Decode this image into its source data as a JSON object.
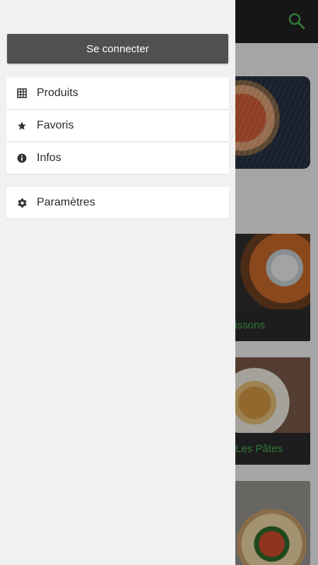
{
  "drawer": {
    "login_button": "Se connecter",
    "items": [
      {
        "label": "Produits",
        "icon": "grid-icon"
      },
      {
        "label": "Favoris",
        "icon": "star-icon"
      },
      {
        "label": "Infos",
        "icon": "info-icon"
      },
      {
        "label": "Paramètres",
        "icon": "gear-icon"
      }
    ]
  },
  "background": {
    "cards": [
      {
        "caption": "oissons"
      },
      {
        "caption": "- Les Pâtes"
      }
    ]
  },
  "colors": {
    "accent": "#4caf50",
    "appbar": "#212121",
    "drawer_bg": "#f1f1f1",
    "login_button_bg": "#505050"
  }
}
